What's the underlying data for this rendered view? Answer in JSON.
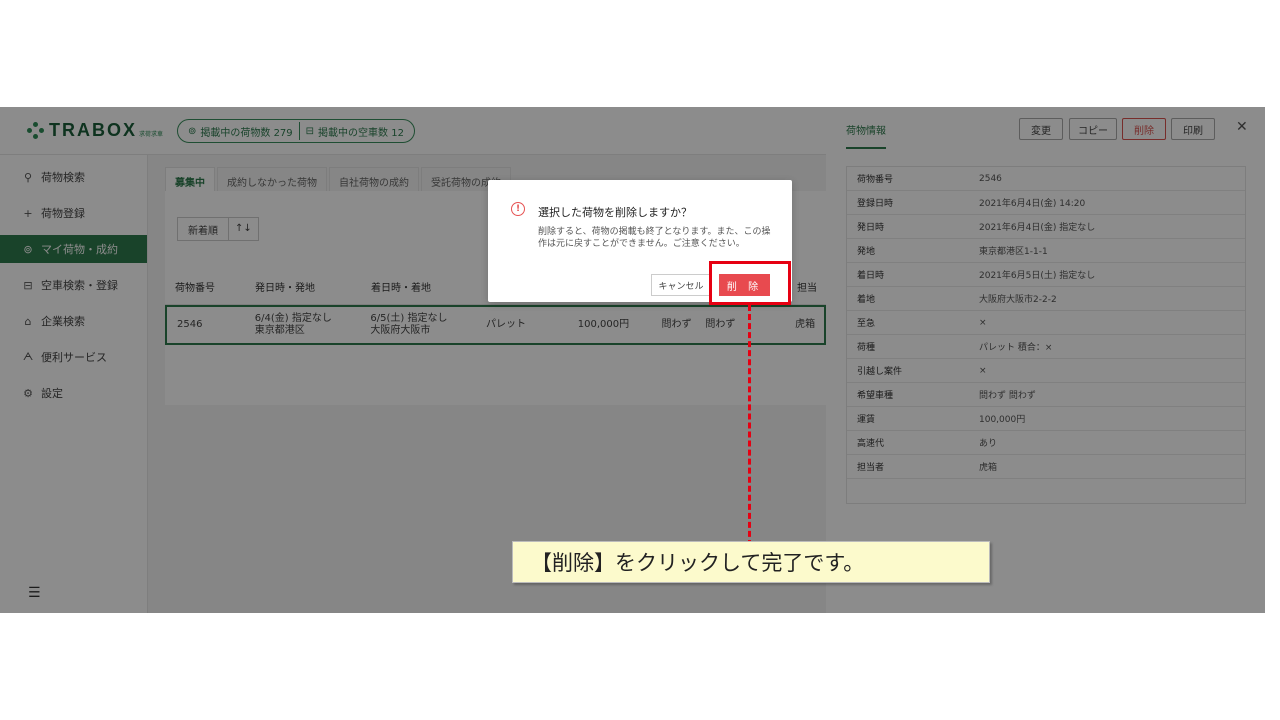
{
  "header": {
    "logo_text": "TRABOX",
    "logo_sub": "求荷求車",
    "pill_cargo": "掲載中の荷物数 279",
    "pill_truck": "掲載中の空車数 12"
  },
  "sidebar": {
    "items": [
      {
        "icon": "search-icon",
        "glyph": "⚲",
        "label": "荷物検索"
      },
      {
        "icon": "plus-icon",
        "glyph": "+",
        "label": "荷物登録"
      },
      {
        "icon": "cargo-icon",
        "glyph": "⊚",
        "label": "マイ荷物・成約"
      },
      {
        "icon": "truck-icon",
        "glyph": "⊟",
        "label": "空車検索・登録"
      },
      {
        "icon": "building-icon",
        "glyph": "⌂",
        "label": "企業検索"
      },
      {
        "icon": "service-icon",
        "glyph": "ᗅ",
        "label": "便利サービス"
      },
      {
        "icon": "gear-icon",
        "glyph": "⚙",
        "label": "設定"
      }
    ],
    "active_index": 2,
    "bottom_glyph": "☰"
  },
  "tabs": [
    "募集中",
    "成約しなかった荷物",
    "自社荷物の成約",
    "受託荷物の成約"
  ],
  "sort": {
    "label": "新着順",
    "arrow": "↑↓"
  },
  "table": {
    "headers": [
      "荷物番号",
      "発日時・発地",
      "着日時・着地",
      "",
      "",
      "",
      "",
      "担当"
    ],
    "row": {
      "id": "2546",
      "dep_date": "6/4(金) 指定なし",
      "dep_place": "東京都港区",
      "arr_date": "6/5(土) 指定なし",
      "arr_place": "大阪府大阪市",
      "type": "パレット",
      "fare": "100,000円",
      "truck1": "問わず",
      "truck2": "問わず",
      "person": "虎箱"
    }
  },
  "right_panel": {
    "title": "荷物情報",
    "buttons": {
      "edit": "変更",
      "copy": "コピー",
      "delete": "削除",
      "print": "印刷"
    },
    "close": "✕",
    "rows": [
      {
        "k": "荷物番号",
        "v": "2546"
      },
      {
        "k": "登録日時",
        "v": "2021年6月4日(金) 14:20"
      },
      {
        "k": "発日時",
        "v": "2021年6月4日(金) 指定なし"
      },
      {
        "k": "発地",
        "v": "東京都港区1-1-1"
      },
      {
        "k": "着日時",
        "v": "2021年6月5日(土) 指定なし"
      },
      {
        "k": "着地",
        "v": "大阪府大阪市2-2-2"
      },
      {
        "k": "至急",
        "v": "×"
      },
      {
        "k": "荷種",
        "v": "パレット 積合：×"
      },
      {
        "k": "引越し案件",
        "v": "×"
      },
      {
        "k": "希望車種",
        "v": "問わず 問わず"
      },
      {
        "k": "運賃",
        "v": "100,000円"
      },
      {
        "k": "高速代",
        "v": "あり"
      },
      {
        "k": "担当者",
        "v": "虎箱"
      },
      {
        "k": "",
        "v": ""
      }
    ]
  },
  "dialog": {
    "icon": "!",
    "title": "選択した荷物を削除しますか？",
    "body": "削除すると、荷物の掲載も終了となります。また、この操作は元に戻すことができません。ご注意ください。",
    "cancel": "キャンセル",
    "delete": "削 除"
  },
  "callout": "【削除】をクリックして完了です。",
  "colors": {
    "brand": "#2f7a4d",
    "danger": "#e84a4f",
    "highlight": "#e60012",
    "callout_bg": "#fcfacc"
  }
}
